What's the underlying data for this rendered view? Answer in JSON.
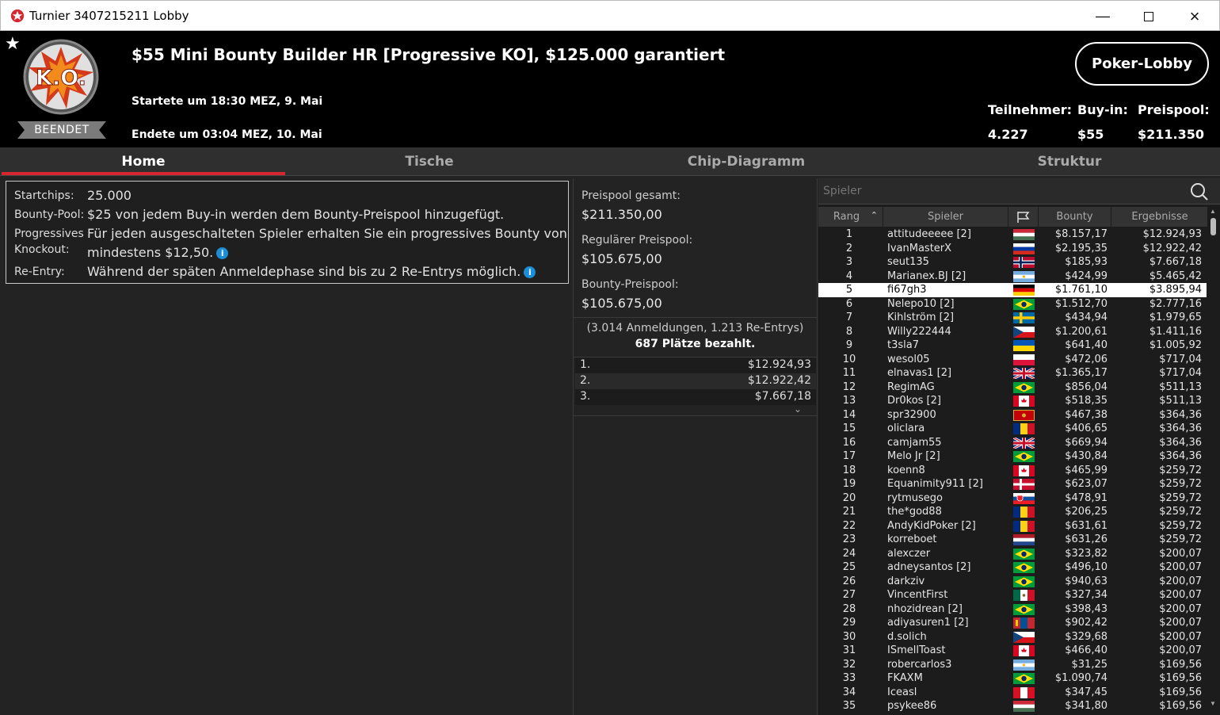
{
  "window": {
    "title": "Turnier 3407215211 Lobby"
  },
  "header": {
    "tournament_name": "$55 Mini Bounty Builder HR [Progressive KO], $125.000 garantiert",
    "started": "Startete um 18:30 MEZ, 9. Mai",
    "ended": "Endete um 03:04 MEZ, 10. Mai",
    "status_badge": "BEENDET",
    "logo_text": "K.O.",
    "lobby_button": "Poker-Lobby",
    "stats": [
      {
        "label": "Teilnehmer:",
        "value": "4.227"
      },
      {
        "label": "Buy-in:",
        "value": "$55"
      },
      {
        "label": "Preispool:",
        "value": "$211.350"
      }
    ]
  },
  "tabs": [
    "Home",
    "Tische",
    "Chip-Diagramm",
    "Struktur"
  ],
  "info": {
    "startchips_label": "Startchips:",
    "startchips_value": "25.000",
    "bounty_label": "Bounty-Pool:",
    "bounty_value": "$25 von jedem Buy-in werden dem Bounty-Preispool hinzugefügt.",
    "pko_label1": "Progressives",
    "pko_label2": "Knockout:",
    "pko_value1": "Für jeden ausgeschalteten Spieler erhalten Sie ein progressives Bounty von",
    "pko_value2": "mindestens $12,50.",
    "reentry_label": "Re-Entry:",
    "reentry_value": "Während der späten Anmeldephase sind bis zu 2 Re-Entrys möglich."
  },
  "prize": {
    "total_label": "Preispool gesamt:",
    "total_value": "$211.350,00",
    "regular_label": "Regulärer Preispool:",
    "regular_value": "$105.675,00",
    "bounty_label": "Bounty-Preispool:",
    "bounty_value": "$105.675,00",
    "entries": "(3.014 Anmeldungen, 1.213 Re-Entrys)",
    "paid": "687 Plätze bezahlt.",
    "places": [
      {
        "place": "1.",
        "amount": "$12.924,93"
      },
      {
        "place": "2.",
        "amount": "$12.922,42"
      },
      {
        "place": "3.",
        "amount": "$7.667,18"
      }
    ]
  },
  "players": {
    "search_placeholder": "Spieler",
    "columns": {
      "rank": "Rang",
      "player": "Spieler",
      "bounty": "Bounty",
      "result": "Ergebnisse"
    },
    "rows": [
      {
        "rank": "1",
        "name": "attitudeeeee [2]",
        "flag": "hungary",
        "bounty": "$8.157,17",
        "result": "$12.924,93"
      },
      {
        "rank": "2",
        "name": "IvanMasterX",
        "flag": "russia",
        "bounty": "$2.195,35",
        "result": "$12.922,42"
      },
      {
        "rank": "3",
        "name": "seut135",
        "flag": "norway",
        "bounty": "$185,93",
        "result": "$7.667,18"
      },
      {
        "rank": "4",
        "name": "Marianex.BJ [2]",
        "flag": "argentina",
        "bounty": "$424,99",
        "result": "$5.465,42"
      },
      {
        "rank": "5",
        "name": "fi67gh3",
        "flag": "germany",
        "bounty": "$1.761,10",
        "result": "$3.895,94"
      },
      {
        "rank": "6",
        "name": "Nelepo10 [2]",
        "flag": "brazil",
        "bounty": "$1.512,70",
        "result": "$2.777,16"
      },
      {
        "rank": "7",
        "name": "Kihlström [2]",
        "flag": "sweden",
        "bounty": "$434,94",
        "result": "$1.979,65"
      },
      {
        "rank": "8",
        "name": "Willy222444",
        "flag": "czech",
        "bounty": "$1.200,61",
        "result": "$1.411,16"
      },
      {
        "rank": "9",
        "name": "t3sla7",
        "flag": "ukraine",
        "bounty": "$641,40",
        "result": "$1.005,92"
      },
      {
        "rank": "10",
        "name": "wesol05",
        "flag": "poland",
        "bounty": "$472,06",
        "result": "$717,04"
      },
      {
        "rank": "11",
        "name": "elnavas1 [2]",
        "flag": "uk",
        "bounty": "$1.365,17",
        "result": "$717,04"
      },
      {
        "rank": "12",
        "name": "RegimAG",
        "flag": "brazil",
        "bounty": "$856,04",
        "result": "$511,13"
      },
      {
        "rank": "13",
        "name": "Dr0kos [2]",
        "flag": "canada",
        "bounty": "$518,35",
        "result": "$511,13"
      },
      {
        "rank": "14",
        "name": "spr32900",
        "flag": "montenegro",
        "bounty": "$467,38",
        "result": "$364,36"
      },
      {
        "rank": "15",
        "name": "oliclara",
        "flag": "romania",
        "bounty": "$406,65",
        "result": "$364,36"
      },
      {
        "rank": "16",
        "name": "camjam55",
        "flag": "uk",
        "bounty": "$669,94",
        "result": "$364,36"
      },
      {
        "rank": "17",
        "name": "Melo Jr [2]",
        "flag": "brazil",
        "bounty": "$430,84",
        "result": "$364,36"
      },
      {
        "rank": "18",
        "name": "koenn8",
        "flag": "canada",
        "bounty": "$465,99",
        "result": "$259,72"
      },
      {
        "rank": "19",
        "name": "Equanimity911 [2]",
        "flag": "denmark",
        "bounty": "$623,07",
        "result": "$259,72"
      },
      {
        "rank": "20",
        "name": "rytmusego",
        "flag": "slovakia",
        "bounty": "$478,91",
        "result": "$259,72"
      },
      {
        "rank": "21",
        "name": "the*god88",
        "flag": "romania",
        "bounty": "$206,25",
        "result": "$259,72"
      },
      {
        "rank": "22",
        "name": "AndyKidPoker [2]",
        "flag": "romania",
        "bounty": "$631,61",
        "result": "$259,72"
      },
      {
        "rank": "23",
        "name": "korreboet",
        "flag": "netherlands",
        "bounty": "$631,26",
        "result": "$259,72"
      },
      {
        "rank": "24",
        "name": "alexczer",
        "flag": "brazil",
        "bounty": "$323,82",
        "result": "$200,07"
      },
      {
        "rank": "25",
        "name": "adneysantos [2]",
        "flag": "brazil",
        "bounty": "$496,10",
        "result": "$200,07"
      },
      {
        "rank": "26",
        "name": "darkziv",
        "flag": "brazil",
        "bounty": "$940,63",
        "result": "$200,07"
      },
      {
        "rank": "27",
        "name": "VincentFirst",
        "flag": "mexico",
        "bounty": "$327,34",
        "result": "$200,07"
      },
      {
        "rank": "28",
        "name": "nhozidrean [2]",
        "flag": "brazil",
        "bounty": "$398,43",
        "result": "$200,07"
      },
      {
        "rank": "29",
        "name": "adiyasuren1 [2]",
        "flag": "mongolia",
        "bounty": "$902,42",
        "result": "$200,07"
      },
      {
        "rank": "30",
        "name": "d.solich",
        "flag": "czech",
        "bounty": "$329,68",
        "result": "$200,07"
      },
      {
        "rank": "31",
        "name": "ISmellToast",
        "flag": "canada",
        "bounty": "$466,40",
        "result": "$200,07"
      },
      {
        "rank": "32",
        "name": "robercarlos3",
        "flag": "argentina",
        "bounty": "$31,25",
        "result": "$169,56"
      },
      {
        "rank": "33",
        "name": "FKAXM",
        "flag": "brazil",
        "bounty": "$1.090,74",
        "result": "$169,56"
      },
      {
        "rank": "34",
        "name": "Iceasl",
        "flag": "peru",
        "bounty": "$347,45",
        "result": "$169,56"
      },
      {
        "rank": "35",
        "name": "psykee86",
        "flag": "hungary",
        "bounty": "$341,80",
        "result": "$169,56"
      }
    ]
  },
  "colors": {
    "accent": "#d7262f",
    "background": "#232323",
    "header": "#000000",
    "highlight_row": "#ffffff"
  }
}
